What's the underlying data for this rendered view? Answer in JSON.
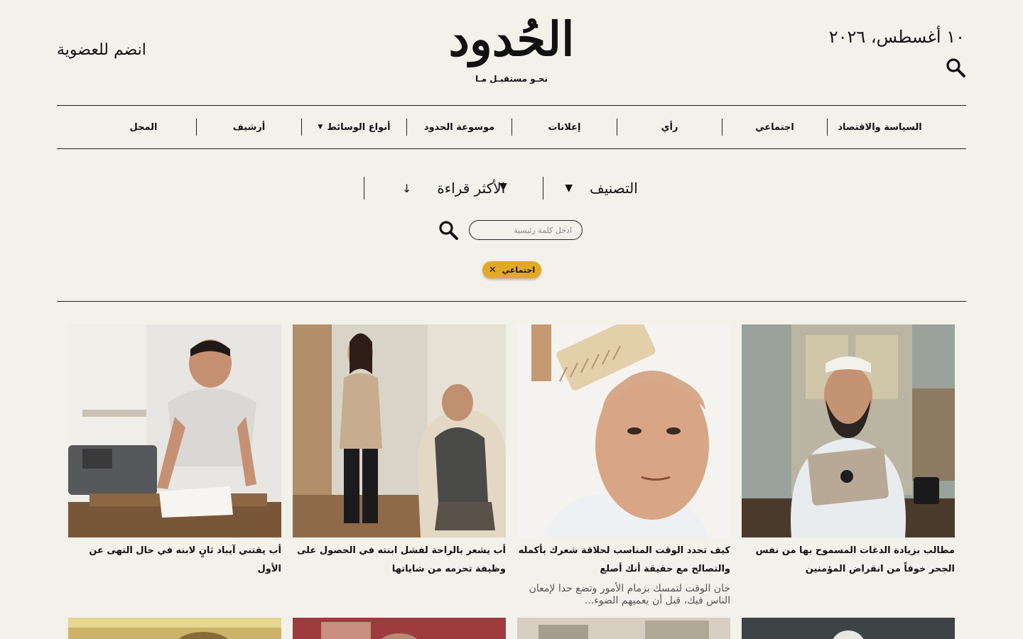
{
  "header": {
    "date": "١٠ أغسطس، ٢٠٢٦",
    "join_label": "انضم للعضوية",
    "logo_text": "الحُدود",
    "logo_tagline": "نحـو مستقبـل مـا",
    "search_icon": "search-icon"
  },
  "nav": {
    "items": [
      {
        "label": "السياسة والاقتصاد"
      },
      {
        "label": "اجتماعي"
      },
      {
        "label": "رأي"
      },
      {
        "label": "إعلانات"
      },
      {
        "label": "موسوعة الحدود"
      },
      {
        "label": "أنواع الوسائط",
        "has_dropdown": true
      },
      {
        "label": "أرشيف"
      },
      {
        "label": "المحل"
      }
    ]
  },
  "filters": {
    "category_label": "التصنيف",
    "sort_label": "الأكثر قراءة",
    "keyword_placeholder": "ادخل كلمة رئيسية",
    "keyword_value": "",
    "active_chip": "اجتماعي",
    "chip_color": "#e2a928"
  },
  "articles": [
    {
      "title": "مطالب بزيادة الدغات المسموح بها من نفس الجحر خوفاً من انقراض المؤمنين",
      "excerpt": ""
    },
    {
      "title": "كيف تحدد الوقت المناسب لحلاقة شعرك بأكمله والتصالح مع حقيقة أنك أصلع",
      "excerpt": "حان الوقت لتمسك بزمام الأمور وتضع حدا لإمعان الناس فيك، قبل أن يعميهم الضوء..."
    },
    {
      "title": "أب يشعر بالراحة لفشل ابنته في الحصول على وظيفة تحرمه من شاياتها",
      "excerpt": ""
    },
    {
      "title": "أب يقتني آيباد ثانٍ لابنه في حال التهى عن الأول",
      "excerpt": ""
    }
  ],
  "colors": {
    "background": "#f2f1ea",
    "text": "#111111",
    "accent": "#e2a928"
  }
}
